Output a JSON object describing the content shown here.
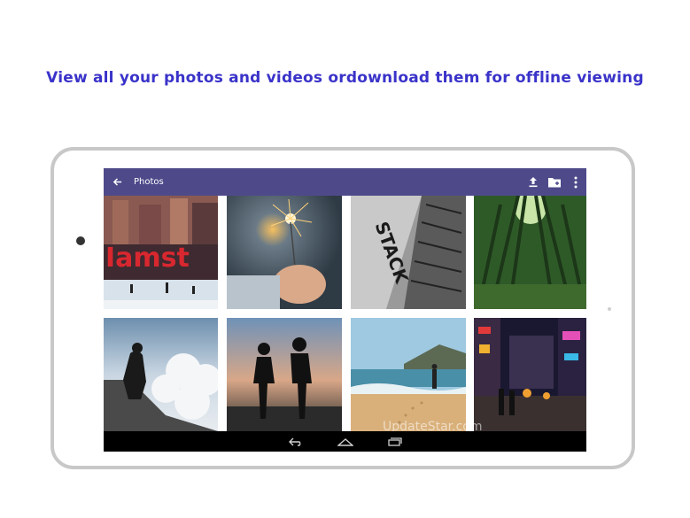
{
  "headline": "View all your photos and videos ordownload them for offline viewing",
  "watermark": "UpdateStar.com",
  "app_bar": {
    "title": "Photos",
    "back_icon": "arrow-left-icon",
    "actions": [
      {
        "name": "upload-button",
        "icon": "upload-icon"
      },
      {
        "name": "new-folder-button",
        "icon": "folder-plus-icon"
      },
      {
        "name": "more-options-button",
        "icon": "more-vertical-icon"
      }
    ]
  },
  "colors": {
    "headline": "#3a33c9",
    "app_bar": "#4e4a8a",
    "tablet_frame": "#c8c8c8",
    "nav_bar": "#000000"
  },
  "photos": [
    {
      "name": "photo-iamsterdam"
    },
    {
      "name": "photo-sparkler"
    },
    {
      "name": "photo-stack-sign"
    },
    {
      "name": "photo-bamboo-forest"
    },
    {
      "name": "photo-man-above-clouds"
    },
    {
      "name": "photo-couple-sunset"
    },
    {
      "name": "photo-beach"
    },
    {
      "name": "photo-city-night"
    }
  ],
  "nav_bar": {
    "buttons": [
      {
        "name": "nav-back-button",
        "icon": "back-icon"
      },
      {
        "name": "nav-home-button",
        "icon": "home-icon"
      },
      {
        "name": "nav-recents-button",
        "icon": "recents-icon"
      }
    ]
  }
}
